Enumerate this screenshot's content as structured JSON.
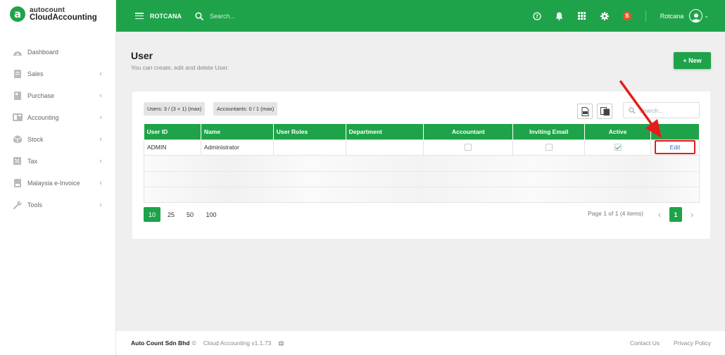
{
  "brand": {
    "top": "autocount",
    "bottom": "CloudAccounting",
    "mark": "a",
    "color": "#1fa34a"
  },
  "header": {
    "company": "ROTCANA",
    "search_placeholder": "Search...",
    "user_initial": "S",
    "username": "Rotcana",
    "icons": [
      "help-icon",
      "bell-icon",
      "apps-grid-icon",
      "gear-icon"
    ]
  },
  "sidebar": {
    "items": [
      {
        "label": "Dashboard",
        "icon": "dashboard-icon",
        "has_children": false
      },
      {
        "label": "Sales",
        "icon": "sales-icon",
        "has_children": true
      },
      {
        "label": "Purchase",
        "icon": "purchase-icon",
        "has_children": true
      },
      {
        "label": "Accounting",
        "icon": "accounting-icon",
        "has_children": true
      },
      {
        "label": "Stock",
        "icon": "stock-icon",
        "has_children": true
      },
      {
        "label": "Tax",
        "icon": "tax-icon",
        "has_children": true
      },
      {
        "label": "Malaysia e-Invoice",
        "icon": "einvoice-icon",
        "has_children": true
      },
      {
        "label": "Tools",
        "icon": "wrench-icon",
        "has_children": true
      }
    ]
  },
  "page": {
    "title": "User",
    "subtitle": "You can create, edit and delete User.",
    "new_button": "+ New"
  },
  "card": {
    "users_chip": "Users: 3 / (3 + 1) (max)",
    "accountants_chip": "Accountants: 0 / 1 (max)",
    "search_placeholder": "Search..."
  },
  "table": {
    "columns": [
      "User ID",
      "Name",
      "User Roles",
      "Department",
      "Accountant",
      "Inviting Email",
      "Active",
      ""
    ],
    "rows": [
      {
        "user_id": "ADMIN",
        "name": "Administrator",
        "user_roles": "",
        "department": "",
        "accountant": false,
        "inviting_email": false,
        "active": true,
        "action": "Edit"
      }
    ]
  },
  "pager": {
    "sizes": [
      "10",
      "25",
      "50",
      "100"
    ],
    "active_size": "10",
    "info": "Page 1 of 1 (4 items)",
    "current_page": "1",
    "prev": "‹",
    "next": "›"
  },
  "footer": {
    "company": "Auto Count Sdn Bhd",
    "copyright": "©",
    "version": "Cloud Accounting v1.1.73",
    "links": [
      "Contact Us",
      "Privacy Policy"
    ]
  },
  "annotation": {
    "color": "#e51c1c"
  }
}
